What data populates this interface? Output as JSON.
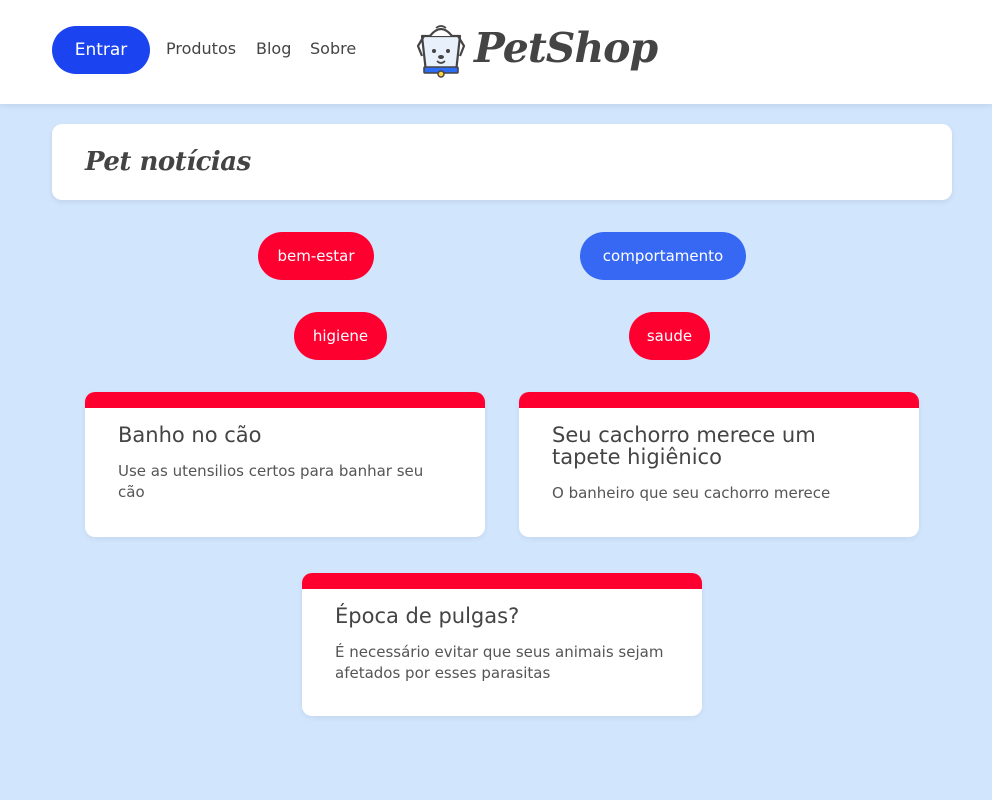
{
  "header": {
    "login_label": "Entrar",
    "nav": [
      "Produtos",
      "Blog",
      "Sobre"
    ],
    "logo_text": "PetShop",
    "logo_icon": "dog-face-icon"
  },
  "page_title": "Pet notícias",
  "tags": [
    {
      "label": "bem-estar",
      "color": "#fe0030"
    },
    {
      "label": "comportamento",
      "color": "#3668f4"
    },
    {
      "label": "higiene",
      "color": "#fe0030"
    },
    {
      "label": "saude",
      "color": "#fe0030"
    }
  ],
  "posts": [
    {
      "title": "Banho no cão",
      "description": "Use as utensilios certos para banhar seu cão"
    },
    {
      "title": "Seu cachorro merece um tapete higiênico",
      "description": "O banheiro que seu cachorro merece"
    },
    {
      "title": "Época de pulgas?",
      "description": "É necessário evitar que seus animais sejam afetados por esses parasitas"
    }
  ],
  "colors": {
    "background": "#d1e5fd",
    "primary_button": "#1b43f0",
    "tag_red": "#fe0030",
    "tag_blue": "#3668f4",
    "card_accent": "#fe0030"
  }
}
